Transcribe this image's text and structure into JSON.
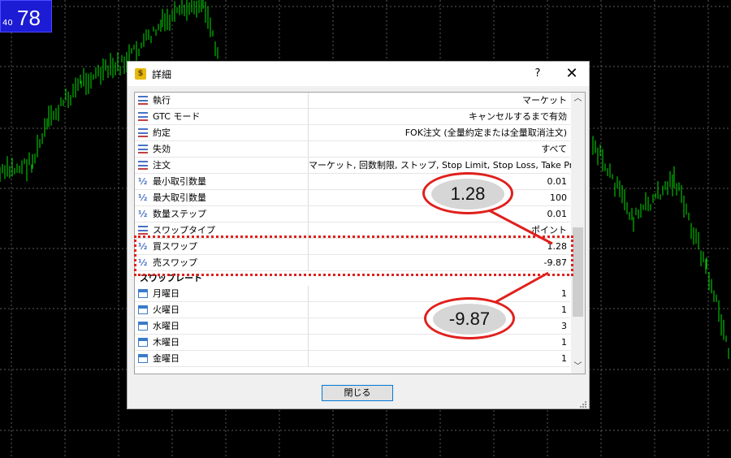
{
  "price_box": {
    "small": "40",
    "big": "78"
  },
  "dialog": {
    "title": "詳細",
    "help": "?",
    "close": "✕",
    "rows": [
      {
        "icon": "list",
        "name": "執行",
        "value": "マーケット"
      },
      {
        "icon": "list",
        "name": "GTC モード",
        "value": "キャンセルするまで有効"
      },
      {
        "icon": "list",
        "name": "約定",
        "value": "FOK注文 (全量約定または全量取消注文)"
      },
      {
        "icon": "list",
        "name": "失効",
        "value": "すべて"
      },
      {
        "icon": "list",
        "name": "注文",
        "value": "マーケット, 回数制限, ストップ, Stop Limit, Stop Loss, Take Profit"
      },
      {
        "icon": "half",
        "name": "最小取引数量",
        "value": "0.01"
      },
      {
        "icon": "half",
        "name": "最大取引数量",
        "value": "100"
      },
      {
        "icon": "half",
        "name": "数量ステップ",
        "value": "0.01"
      },
      {
        "icon": "list",
        "name": "スワップタイプ",
        "value": "ポイント"
      },
      {
        "icon": "half",
        "name": "買スワップ",
        "value": "1.28"
      },
      {
        "icon": "half",
        "name": "売スワップ",
        "value": "-9.87"
      }
    ],
    "section": "スワップレート",
    "days": [
      {
        "name": "月曜日",
        "value": "1"
      },
      {
        "name": "火曜日",
        "value": "1"
      },
      {
        "name": "水曜日",
        "value": "3"
      },
      {
        "name": "木曜日",
        "value": "1"
      },
      {
        "name": "金曜日",
        "value": "1"
      }
    ],
    "close_button": "閉じる"
  },
  "callouts": {
    "buy_swap": "1.28",
    "sell_swap": "-9.87"
  },
  "colors": {
    "chart_line": "#00e000",
    "highlight": "#e0201c",
    "accent": "#0078d7"
  }
}
